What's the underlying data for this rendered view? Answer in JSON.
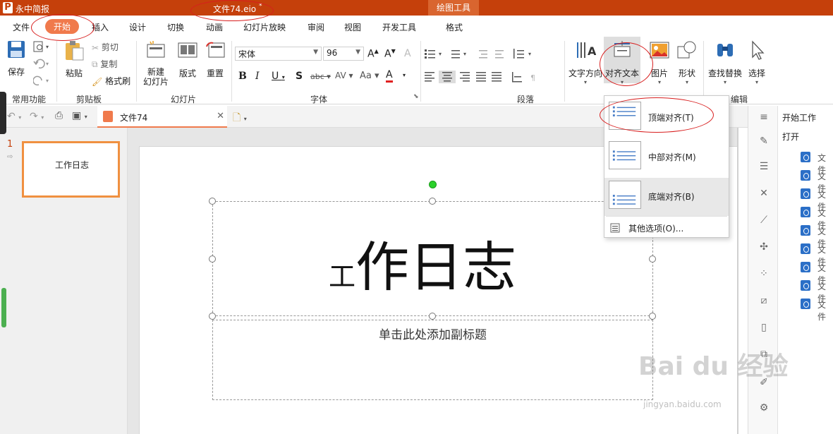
{
  "titlebar": {
    "app": "永中简报",
    "doc": "文件74.eio",
    "modified_mark": "*",
    "context_tab": "绘图工具"
  },
  "menu": [
    "文件",
    "开始",
    "插入",
    "设计",
    "切换",
    "动画",
    "幻灯片放映",
    "审阅",
    "视图",
    "开发工具",
    "格式"
  ],
  "ribbon": {
    "save": "保存",
    "paste": "粘贴",
    "cut": "剪切",
    "copy": "复制",
    "format_painter": "格式刷",
    "new_slide": "新建\n幻灯片",
    "layout": "版式",
    "reset": "重置",
    "font_name": "宋体",
    "font_size": "96",
    "text_direction": "文字方向",
    "align_text": "对齐文本",
    "picture": "图片",
    "shape": "形状",
    "find_replace": "查找替换",
    "select": "选择",
    "groups": {
      "common": "常用功能",
      "clipboard": "剪贴板",
      "slides": "幻灯片",
      "font": "字体",
      "paragraph": "段落",
      "edit": "编辑"
    }
  },
  "doc_tab": "文件74",
  "slide_panel": {
    "number": "1",
    "thumb_text": "工作日志"
  },
  "slide": {
    "title_small": "工",
    "title": "作日志",
    "subtitle_placeholder": "单击此处添加副标题"
  },
  "dropdown": {
    "items": [
      "顶端对齐(T)",
      "中部对齐(M)",
      "底端对齐(B)"
    ],
    "more": "其他选项(O)..."
  },
  "taskpane": {
    "title": "开始工作",
    "open": "打开",
    "files": [
      "文件",
      "文件",
      "文件",
      "文件",
      "文件",
      "文件",
      "文件",
      "文件",
      "文件"
    ]
  },
  "watermark": {
    "main": "Bai du 经验",
    "url": "jingyan.baidu.com"
  },
  "colors": {
    "brand": "#c5400b",
    "active_tab": "#f07a4c",
    "annotation": "#d81e1e"
  }
}
